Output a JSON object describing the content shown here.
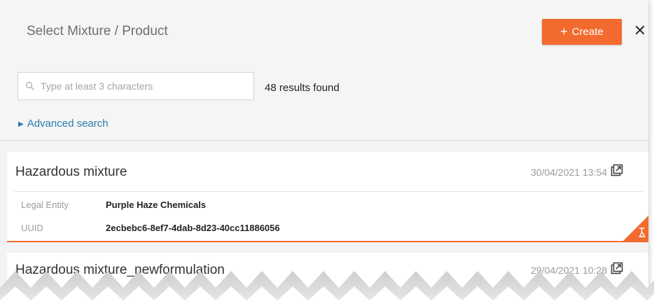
{
  "dialog": {
    "title": "Select Mixture / Product",
    "create_label": "Create",
    "close_icon": "close-icon"
  },
  "search": {
    "placeholder": "Type at least 3 characters",
    "value": "",
    "results_text": "48 results found",
    "advanced_label": "Advanced search"
  },
  "results": [
    {
      "name": "Hazardous mixture",
      "date": "30/04/2021 13:54",
      "fields": [
        {
          "label": "Legal Entity",
          "value": "Purple Haze Chemicals"
        },
        {
          "label": "UUID",
          "value": "2ecbebc6-8ef7-4dab-8d23-40cc11886056"
        }
      ]
    },
    {
      "name": "Hazardous mixture_newformulation",
      "date": "29/04/2021 10:28"
    }
  ],
  "colors": {
    "accent": "#f26a2e",
    "link": "#2b7cad"
  }
}
